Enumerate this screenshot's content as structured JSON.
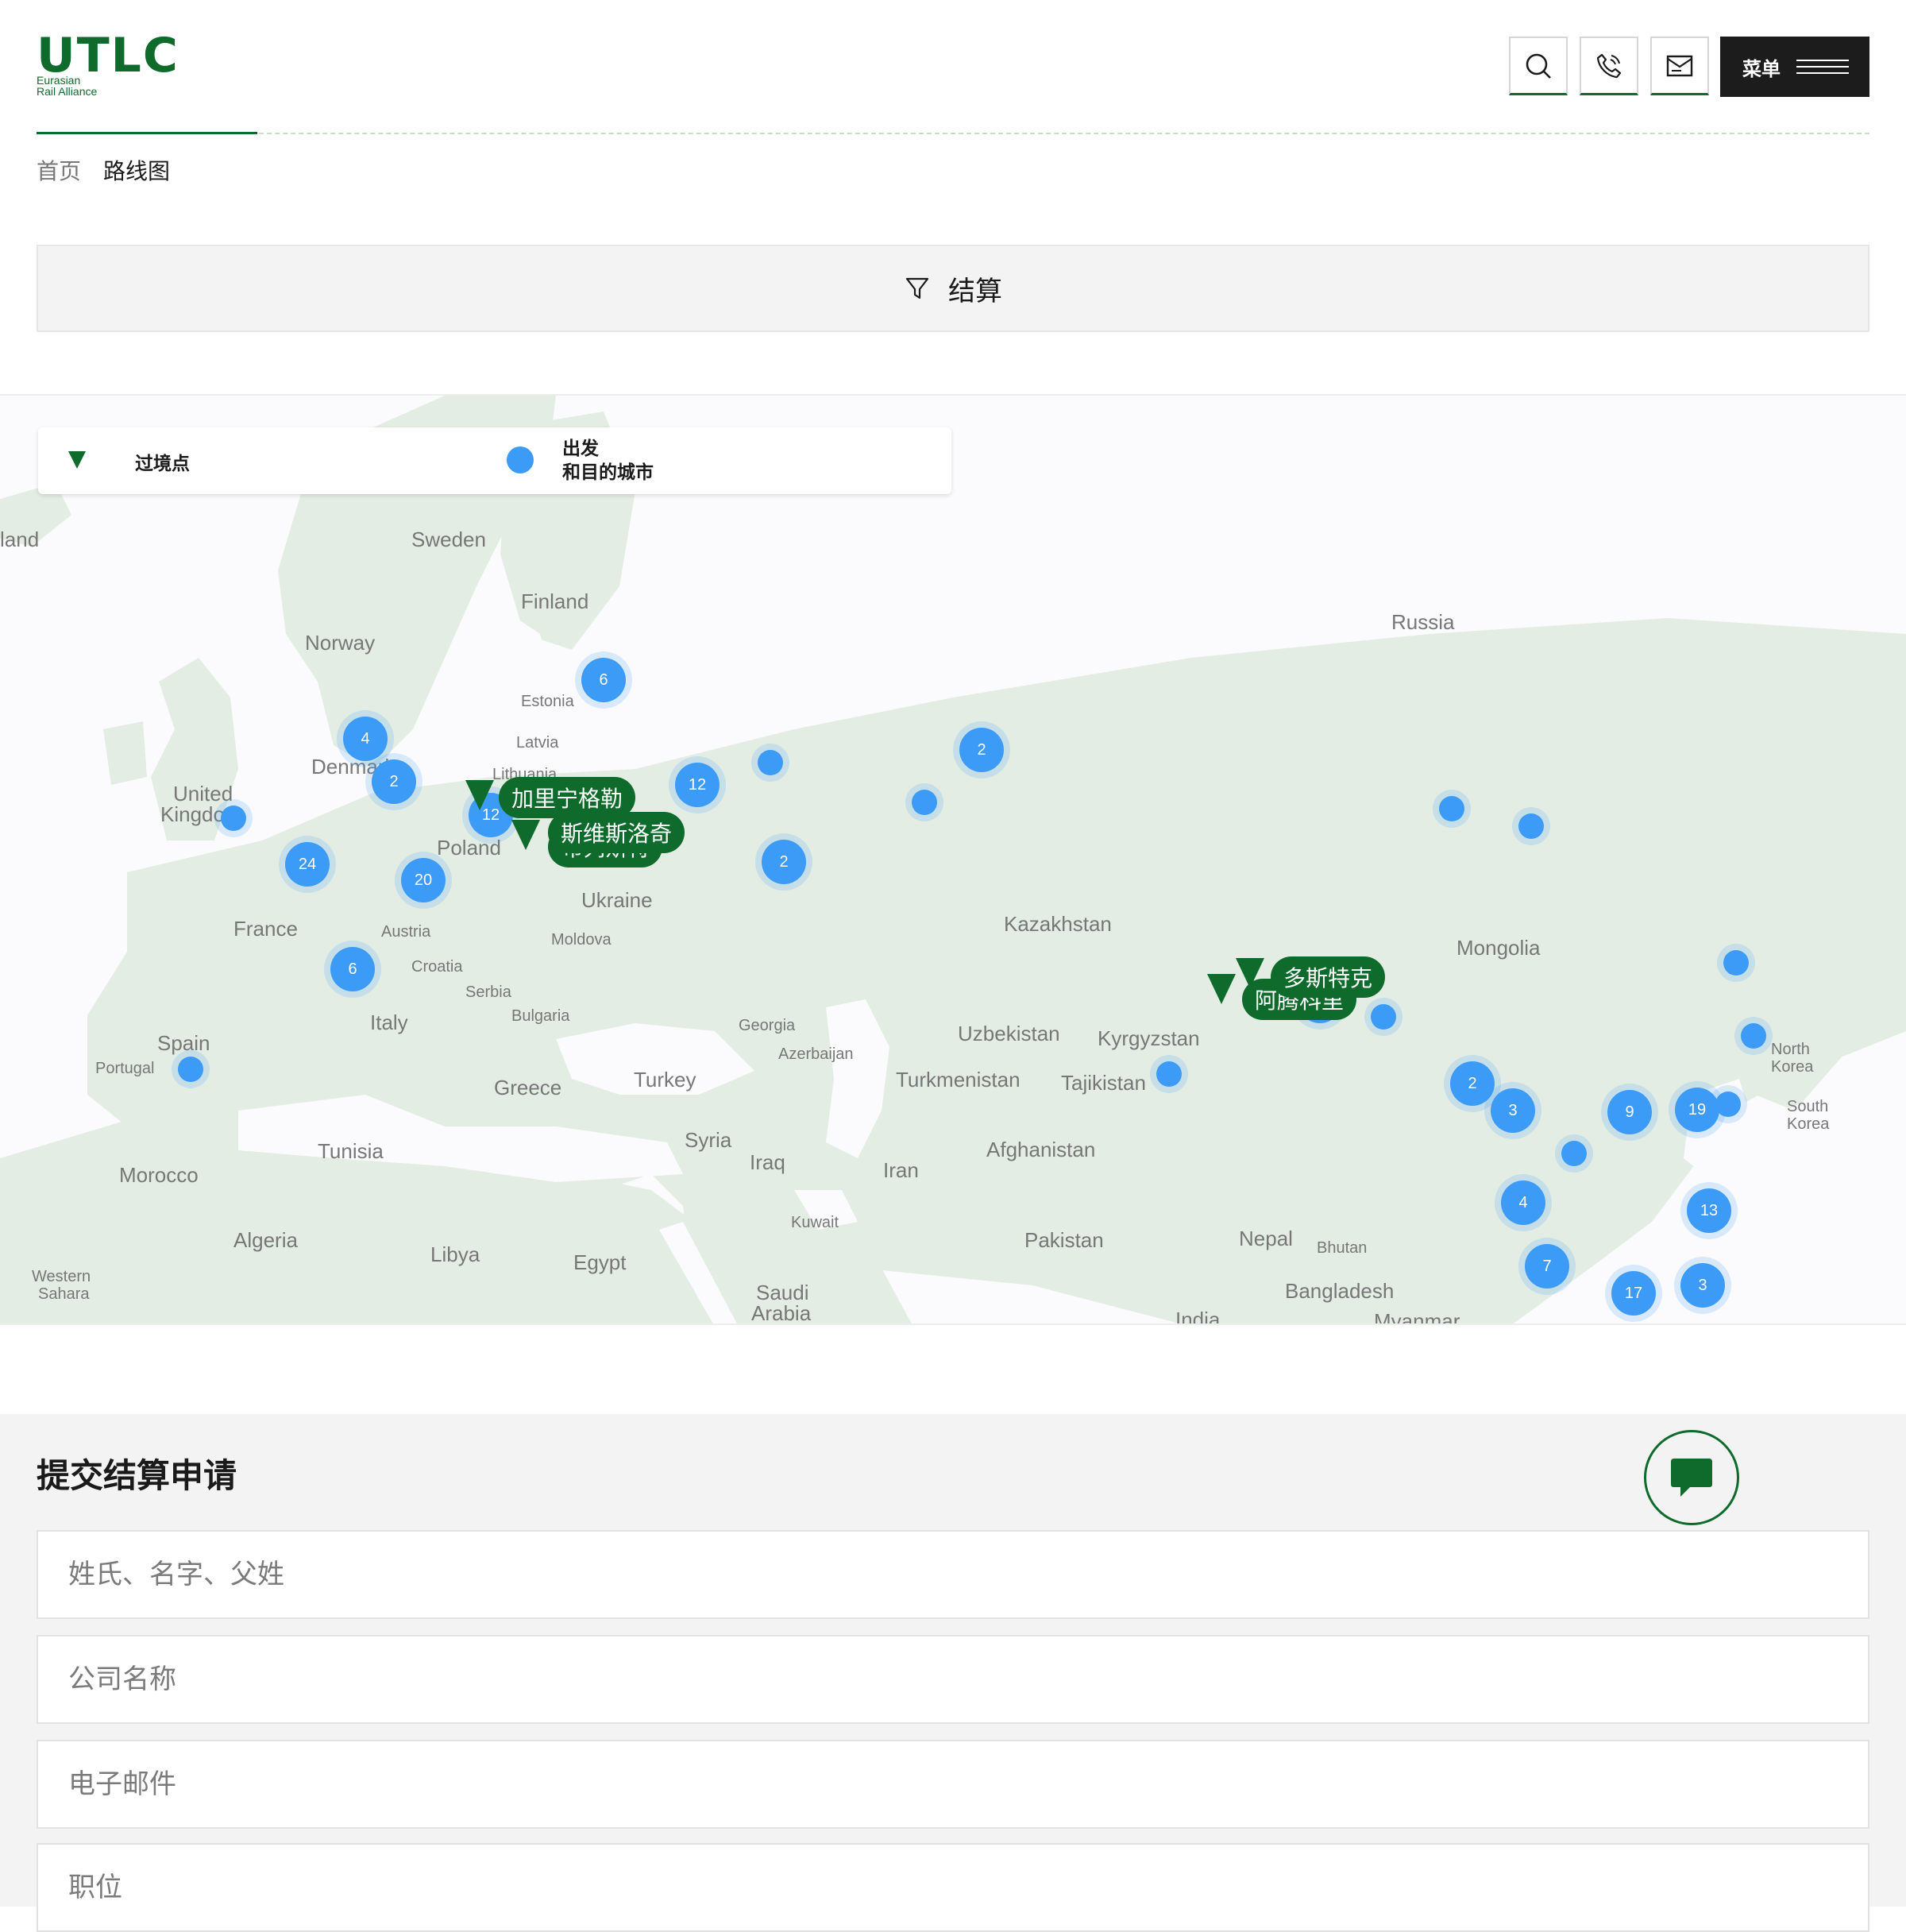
{
  "brand": {
    "logo_text": "UTLC",
    "logo_sub_line1": "Eurasian",
    "logo_sub_line2": "Rail Alliance",
    "accent_color": "#0e6b2b"
  },
  "header": {
    "icons": [
      "search-icon",
      "phone-icon",
      "mail-icon"
    ],
    "menu_label": "菜单"
  },
  "breadcrumb": {
    "home": "首页",
    "current": "路线图"
  },
  "filter": {
    "label": "结算"
  },
  "legend": {
    "border_point": "过境点",
    "city_line1": "出发",
    "city_line2": "和目的城市"
  },
  "map": {
    "places": [
      {
        "name": "land"
      },
      {
        "name": "Sweden"
      },
      {
        "name": "Finland"
      },
      {
        "name": "Norway"
      },
      {
        "name": "Russia"
      },
      {
        "name": "Estonia"
      },
      {
        "name": "Latvia"
      },
      {
        "name": "Lithuania"
      },
      {
        "name": "Denmark"
      },
      {
        "name": "United"
      },
      {
        "name": "Kingdom"
      },
      {
        "name": "Poland"
      },
      {
        "name": "Ukraine"
      },
      {
        "name": "France"
      },
      {
        "name": "Austria"
      },
      {
        "name": "Moldova"
      },
      {
        "name": "Kazakhstan"
      },
      {
        "name": "Mongolia"
      },
      {
        "name": "Croatia"
      },
      {
        "name": "Serbia"
      },
      {
        "name": "Italy"
      },
      {
        "name": "Bulgaria"
      },
      {
        "name": "Georgia"
      },
      {
        "name": "Uzbekistan"
      },
      {
        "name": "Kyrgyzstan"
      },
      {
        "name": "Spain"
      },
      {
        "name": "Portugal"
      },
      {
        "name": "Azerbaijan"
      },
      {
        "name": "Greece"
      },
      {
        "name": "Turkey"
      },
      {
        "name": "Turkmenistan"
      },
      {
        "name": "Tajikistan"
      },
      {
        "name": "North"
      },
      {
        "name": "Korea"
      },
      {
        "name": "South"
      },
      {
        "name": "Korea"
      },
      {
        "name": "Syria"
      },
      {
        "name": "Tunisia"
      },
      {
        "name": "Morocco"
      },
      {
        "name": "Iraq"
      },
      {
        "name": "Iran"
      },
      {
        "name": "Afghanistan"
      },
      {
        "name": "Kuwait"
      },
      {
        "name": "Algeria"
      },
      {
        "name": "Libya"
      },
      {
        "name": "Egypt"
      },
      {
        "name": "Pakistan"
      },
      {
        "name": "Nepal"
      },
      {
        "name": "Bhutan"
      },
      {
        "name": "Western"
      },
      {
        "name": "Sahara"
      },
      {
        "name": "Saudi"
      },
      {
        "name": "Arabia"
      },
      {
        "name": "Bangladesh"
      },
      {
        "name": "India"
      },
      {
        "name": "Myanmar"
      }
    ],
    "clusters": [
      "6",
      "4",
      "2",
      "12",
      "12",
      "2",
      "24",
      "20",
      "2",
      "6",
      "2",
      "2",
      "3",
      "9",
      "19",
      "4",
      "13",
      "7",
      "17",
      "3"
    ],
    "pins": {
      "kaliningrad": "加里宁格勒",
      "svislach": "斯维斯洛奇",
      "brest": "布列斯特",
      "dostyk": "多斯特克",
      "altynkol": "阿腾科里"
    }
  },
  "form": {
    "title": "提交结算申请",
    "fields": [
      {
        "placeholder": "姓氏、名字、父姓"
      },
      {
        "placeholder": "公司名称"
      },
      {
        "placeholder": "电子邮件"
      },
      {
        "placeholder": "职位"
      }
    ]
  }
}
